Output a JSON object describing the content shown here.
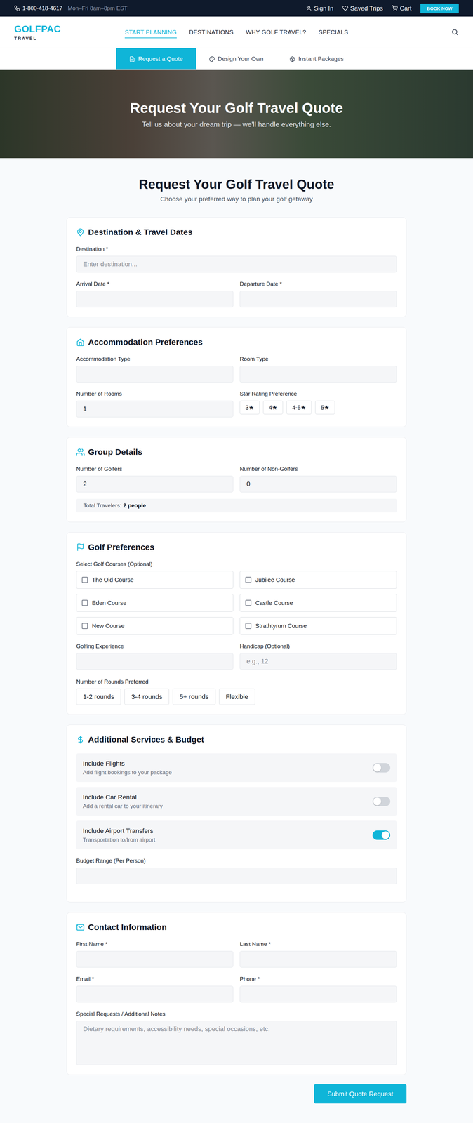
{
  "topbar": {
    "phone": "1-800-418-4617",
    "hours": "Mon–Fri 8am–8pm EST",
    "links": [
      "Sign In",
      "Saved Trips",
      "Cart"
    ],
    "cta": "BOOK NOW"
  },
  "logo": {
    "name": "GOLFPAC",
    "tagline": "TRAVEL"
  },
  "nav": [
    {
      "label": "START PLANNING",
      "selected": true
    },
    {
      "label": "DESTINATIONS",
      "selected": false
    },
    {
      "label": "WHY GOLF TRAVEL?",
      "selected": false
    },
    {
      "label": "SPECIALS",
      "selected": false
    }
  ],
  "subtabs": [
    {
      "label": "Request a Quote",
      "selected": true
    },
    {
      "label": "Design Your Own",
      "selected": false
    },
    {
      "label": "Instant Packages",
      "selected": false
    }
  ],
  "hero": {
    "title": "Request Your Golf Travel Quote",
    "subtitle": "Tell us about your dream trip — we'll handle everything else."
  },
  "heading": {
    "title": "Request Your Golf Travel Quote",
    "subtitle": "Choose your preferred way to plan your golf getaway"
  },
  "destination": {
    "title": "Destination & Travel Dates",
    "destination": {
      "label": "Destination *",
      "value": "",
      "placeholder": "Enter destination..."
    },
    "arrival": {
      "label": "Arrival Date *",
      "value": "",
      "placeholder": ""
    },
    "departure": {
      "label": "Departure Date *",
      "value": "",
      "placeholder": ""
    }
  },
  "accommodation": {
    "title": "Accommodation Preferences",
    "type": {
      "label": "Accommodation Type",
      "value": "",
      "placeholder": ""
    },
    "room": {
      "label": "Room Type",
      "value": "",
      "placeholder": ""
    },
    "rooms": {
      "label": "Number of Rooms",
      "value": "1",
      "placeholder": ""
    },
    "stars": {
      "label": "Star Rating Preference",
      "options": [
        {
          "label": "3★",
          "selected": false
        },
        {
          "label": "4★",
          "selected": false
        },
        {
          "label": "4-5★",
          "selected": false
        },
        {
          "label": "5★",
          "selected": false
        }
      ]
    }
  },
  "group": {
    "title": "Group Details",
    "golfers": {
      "label": "Number of Golfers",
      "value": "2",
      "placeholder": ""
    },
    "nongolfers": {
      "label": "Number of Non-Golfers",
      "value": "0",
      "placeholder": ""
    },
    "total": {
      "label": "Total Travelers:",
      "value": "2 people"
    }
  },
  "golf": {
    "title": "Golf Preferences",
    "courses_label": "Select Golf Courses (Optional)",
    "courses": [
      {
        "name": "The Old Course",
        "checked": false
      },
      {
        "name": "Jubilee Course",
        "checked": false
      },
      {
        "name": "Eden Course",
        "checked": false
      },
      {
        "name": "Castle Course",
        "checked": false
      },
      {
        "name": "New Course",
        "checked": false
      },
      {
        "name": "Strathtyrum Course",
        "checked": false
      }
    ],
    "experience": {
      "label": "Golfing Experience",
      "value": "",
      "placeholder": ""
    },
    "handicap": {
      "label": "Handicap (Optional)",
      "value": "",
      "placeholder": "e.g., 12"
    },
    "rounds": {
      "label": "Number of Rounds Preferred",
      "options": [
        {
          "label": "1-2 rounds",
          "selected": false
        },
        {
          "label": "3-4 rounds",
          "selected": false
        },
        {
          "label": "5+ rounds",
          "selected": false
        },
        {
          "label": "Flexible",
          "selected": false
        }
      ]
    }
  },
  "services": {
    "title": "Additional Services & Budget",
    "toggles": [
      {
        "title": "Include Flights",
        "subtitle": "Add flight bookings to your package",
        "on": false
      },
      {
        "title": "Include Car Rental",
        "subtitle": "Add a rental car to your itinerary",
        "on": false
      },
      {
        "title": "Include Airport Transfers",
        "subtitle": "Transportation to/from airport",
        "on": true
      }
    ],
    "budget": {
      "label": "Budget Range (Per Person)",
      "value": "",
      "placeholder": ""
    }
  },
  "contact": {
    "title": "Contact Information",
    "first": {
      "label": "First Name *",
      "value": "",
      "placeholder": ""
    },
    "last": {
      "label": "Last Name *",
      "value": "",
      "placeholder": ""
    },
    "email": {
      "label": "Email *",
      "value": "",
      "placeholder": ""
    },
    "phone": {
      "label": "Phone *",
      "value": "",
      "placeholder": ""
    },
    "notes": {
      "label": "Special Requests / Additional Notes",
      "value": "",
      "placeholder": "Dietary requirements, accessibility needs, special occasions, etc."
    }
  },
  "submit": "Submit Quote Request"
}
